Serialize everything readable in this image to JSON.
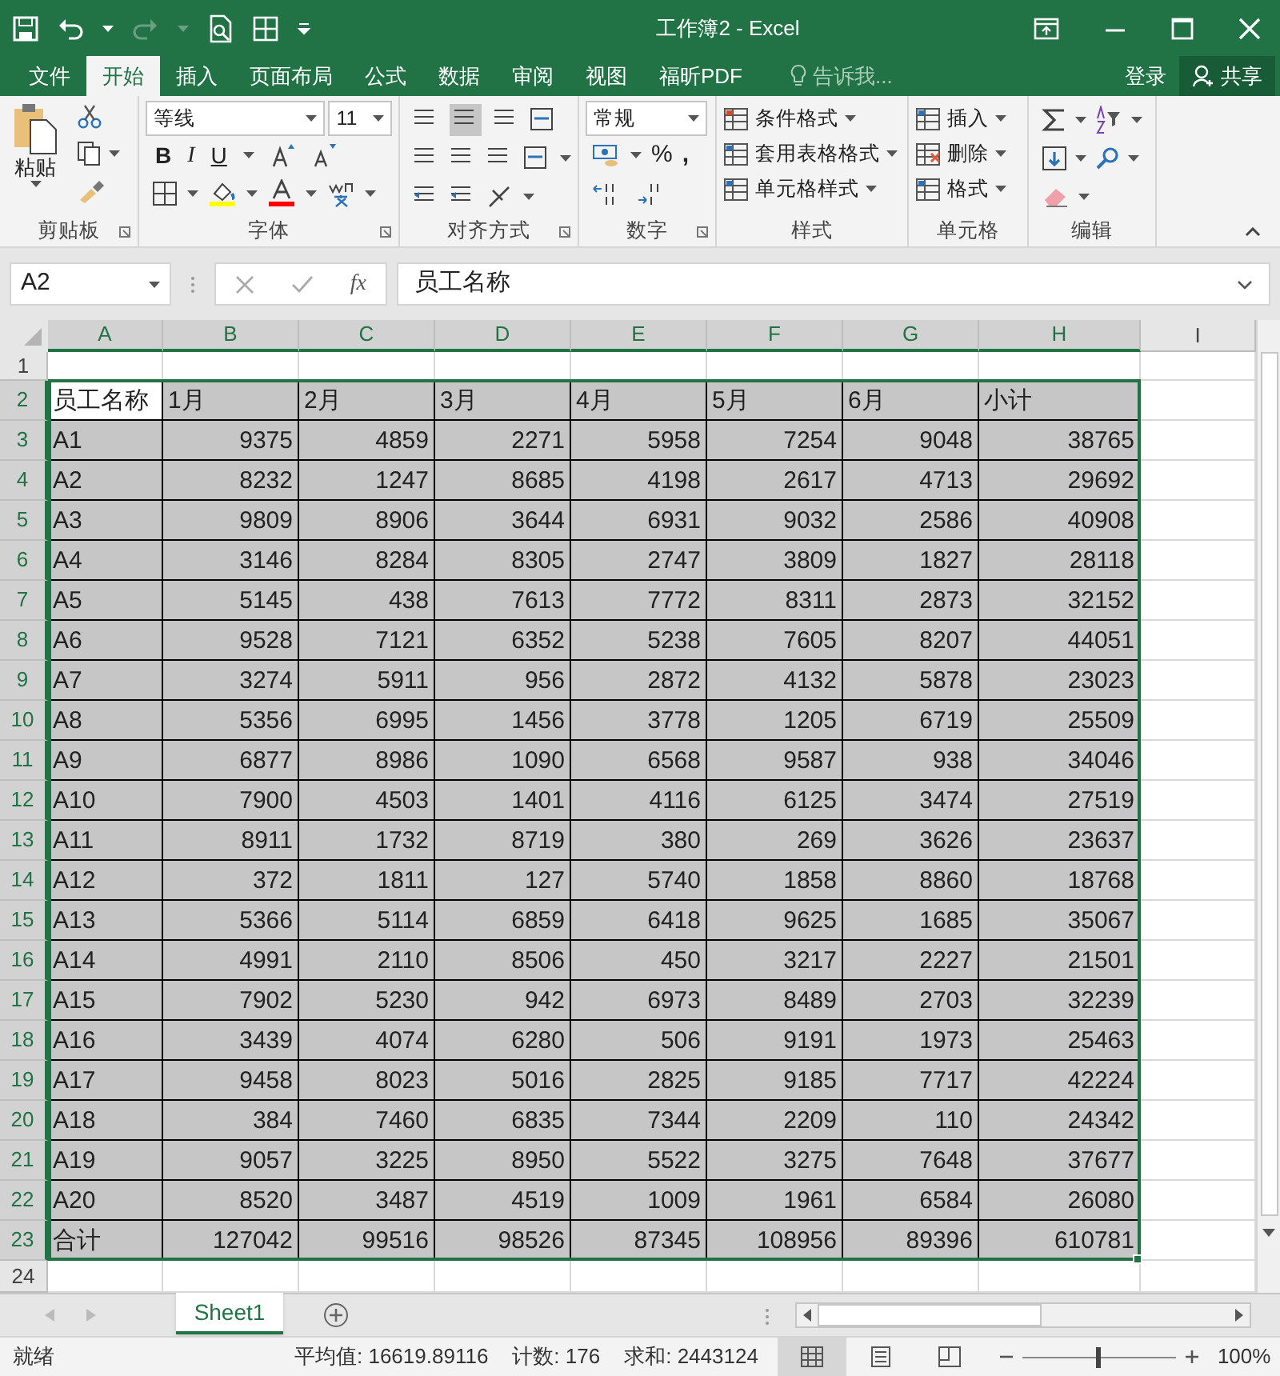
{
  "window": {
    "title": "工作簿2 - Excel"
  },
  "tabs": [
    {
      "label": "文件",
      "selected": false
    },
    {
      "label": "开始",
      "selected": true
    },
    {
      "label": "插入",
      "selected": false
    },
    {
      "label": "页面布局",
      "selected": false
    },
    {
      "label": "公式",
      "selected": false
    },
    {
      "label": "数据",
      "selected": false
    },
    {
      "label": "审阅",
      "selected": false
    },
    {
      "label": "视图",
      "selected": false
    },
    {
      "label": "福昕PDF",
      "selected": false
    }
  ],
  "tell_me": {
    "placeholder": "告诉我..."
  },
  "account": {
    "sign_in": "登录",
    "share": "共享"
  },
  "ribbon": {
    "groups": [
      {
        "label": "剪贴板",
        "kind": "clipboard",
        "paste": "粘贴"
      },
      {
        "label": "字体",
        "kind": "font",
        "font": "等线",
        "size": "11",
        "bold": "B",
        "italic": "I",
        "underline": "U"
      },
      {
        "label": "对齐方式",
        "kind": "alignment"
      },
      {
        "label": "数字",
        "kind": "number",
        "format": "常规",
        "percent": "%",
        "comma": ","
      },
      {
        "label": "样式",
        "kind": "styles",
        "buttons": [
          "条件格式",
          "套用表格格式",
          "单元格样式"
        ]
      },
      {
        "label": "单元格",
        "kind": "cells",
        "buttons": [
          "插入",
          "删除",
          "格式"
        ]
      },
      {
        "label": "编辑",
        "kind": "editing"
      }
    ]
  },
  "formula_bar": {
    "name_box": "A2",
    "fx": "fx",
    "value": "员工名称"
  },
  "columns": [
    {
      "label": "A",
      "selected": true
    },
    {
      "label": "B",
      "selected": true
    },
    {
      "label": "C",
      "selected": true
    },
    {
      "label": "D",
      "selected": true
    },
    {
      "label": "E",
      "selected": true
    },
    {
      "label": "F",
      "selected": true
    },
    {
      "label": "G",
      "selected": true
    },
    {
      "label": "H",
      "selected": true
    },
    {
      "label": "I",
      "selected": false
    }
  ],
  "rows": [
    {
      "header": "1",
      "selected": false,
      "kind": "empty",
      "cells": []
    },
    {
      "header": "2",
      "selected": true,
      "kind": "header",
      "cells": [
        "员工名称",
        "1月",
        "2月",
        "3月",
        "4月",
        "5月",
        "6月",
        "小计"
      ]
    },
    {
      "header": "3",
      "selected": true,
      "kind": "data",
      "cells": [
        "A1",
        "9375",
        "4859",
        "2271",
        "5958",
        "7254",
        "9048",
        "38765"
      ]
    },
    {
      "header": "4",
      "selected": true,
      "kind": "data",
      "cells": [
        "A2",
        "8232",
        "1247",
        "8685",
        "4198",
        "2617",
        "4713",
        "29692"
      ]
    },
    {
      "header": "5",
      "selected": true,
      "kind": "data",
      "cells": [
        "A3",
        "9809",
        "8906",
        "3644",
        "6931",
        "9032",
        "2586",
        "40908"
      ]
    },
    {
      "header": "6",
      "selected": true,
      "kind": "data",
      "cells": [
        "A4",
        "3146",
        "8284",
        "8305",
        "2747",
        "3809",
        "1827",
        "28118"
      ]
    },
    {
      "header": "7",
      "selected": true,
      "kind": "data",
      "cells": [
        "A5",
        "5145",
        "438",
        "7613",
        "7772",
        "8311",
        "2873",
        "32152"
      ]
    },
    {
      "header": "8",
      "selected": true,
      "kind": "data",
      "cells": [
        "A6",
        "9528",
        "7121",
        "6352",
        "5238",
        "7605",
        "8207",
        "44051"
      ]
    },
    {
      "header": "9",
      "selected": true,
      "kind": "data",
      "cells": [
        "A7",
        "3274",
        "5911",
        "956",
        "2872",
        "4132",
        "5878",
        "23023"
      ]
    },
    {
      "header": "10",
      "selected": true,
      "kind": "data",
      "cells": [
        "A8",
        "5356",
        "6995",
        "1456",
        "3778",
        "1205",
        "6719",
        "25509"
      ]
    },
    {
      "header": "11",
      "selected": true,
      "kind": "data",
      "cells": [
        "A9",
        "6877",
        "8986",
        "1090",
        "6568",
        "9587",
        "938",
        "34046"
      ]
    },
    {
      "header": "12",
      "selected": true,
      "kind": "data",
      "cells": [
        "A10",
        "7900",
        "4503",
        "1401",
        "4116",
        "6125",
        "3474",
        "27519"
      ]
    },
    {
      "header": "13",
      "selected": true,
      "kind": "data",
      "cells": [
        "A11",
        "8911",
        "1732",
        "8719",
        "380",
        "269",
        "3626",
        "23637"
      ]
    },
    {
      "header": "14",
      "selected": true,
      "kind": "data",
      "cells": [
        "A12",
        "372",
        "1811",
        "127",
        "5740",
        "1858",
        "8860",
        "18768"
      ]
    },
    {
      "header": "15",
      "selected": true,
      "kind": "data",
      "cells": [
        "A13",
        "5366",
        "5114",
        "6859",
        "6418",
        "9625",
        "1685",
        "35067"
      ]
    },
    {
      "header": "16",
      "selected": true,
      "kind": "data",
      "cells": [
        "A14",
        "4991",
        "2110",
        "8506",
        "450",
        "3217",
        "2227",
        "21501"
      ]
    },
    {
      "header": "17",
      "selected": true,
      "kind": "data",
      "cells": [
        "A15",
        "7902",
        "5230",
        "942",
        "6973",
        "8489",
        "2703",
        "32239"
      ]
    },
    {
      "header": "18",
      "selected": true,
      "kind": "data",
      "cells": [
        "A16",
        "3439",
        "4074",
        "6280",
        "506",
        "9191",
        "1973",
        "25463"
      ]
    },
    {
      "header": "19",
      "selected": true,
      "kind": "data",
      "cells": [
        "A17",
        "9458",
        "8023",
        "5016",
        "2825",
        "9185",
        "7717",
        "42224"
      ]
    },
    {
      "header": "20",
      "selected": true,
      "kind": "data",
      "cells": [
        "A18",
        "384",
        "7460",
        "6835",
        "7344",
        "2209",
        "110",
        "24342"
      ]
    },
    {
      "header": "21",
      "selected": true,
      "kind": "data",
      "cells": [
        "A19",
        "9057",
        "3225",
        "8950",
        "5522",
        "3275",
        "7648",
        "37677"
      ]
    },
    {
      "header": "22",
      "selected": true,
      "kind": "data",
      "cells": [
        "A20",
        "8520",
        "3487",
        "4519",
        "1009",
        "1961",
        "6584",
        "26080"
      ]
    },
    {
      "header": "23",
      "selected": true,
      "kind": "data",
      "cells": [
        "合计",
        "127042",
        "99516",
        "98526",
        "87345",
        "108956",
        "89396",
        "610781"
      ]
    },
    {
      "header": "24",
      "selected": false,
      "kind": "empty",
      "cells": []
    }
  ],
  "sheets": [
    {
      "label": "Sheet1",
      "selected": true
    }
  ],
  "status_bar": {
    "ready": "就绪",
    "average": "平均值: 16619.89116",
    "count": "计数: 176",
    "sum": "求和: 2443124",
    "views": [
      {
        "kind": "normal",
        "selected": true
      },
      {
        "kind": "page_layout",
        "selected": false
      },
      {
        "kind": "page_break",
        "selected": false
      }
    ],
    "zoom": {
      "level": 0.5,
      "reading": "100%"
    }
  }
}
